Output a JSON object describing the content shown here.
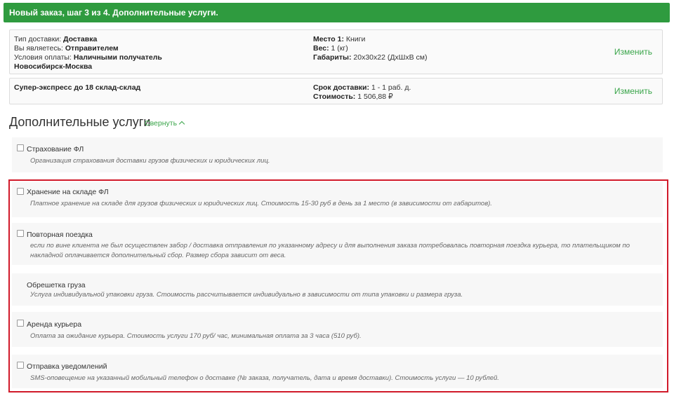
{
  "header": {
    "title": "Новый заказ, шаг 3 из 4. Дополнительные услуги."
  },
  "summary": {
    "delivery_type_label": "Тип доставки:",
    "delivery_type_value": "Доставка",
    "role_label": "Вы являетесь:",
    "role_value": "Отправителем",
    "payment_label": "Условия оплаты:",
    "payment_value": "Наличными получатель",
    "route": "Новосибирск-Москва",
    "place_label": "Место 1:",
    "place_value": "Книги",
    "weight_label": "Вес:",
    "weight_value": "1 (кг)",
    "dims_label": "Габариты:",
    "dims_value": "20x30x22 (ДхШхВ см)",
    "change_label": "Изменить"
  },
  "tariff": {
    "name": "Супер-экспресс до 18 склад-склад",
    "term_label": "Срок доставки:",
    "term_value": "1 - 1 раб. д.",
    "cost_label": "Стоимость:",
    "cost_value": "1 506,88 ₽",
    "change_label": "Изменить"
  },
  "section": {
    "title": "Дополнительные услуги",
    "collapse_label": "Свернуть"
  },
  "services": [
    {
      "title": "Страхование ФЛ",
      "checkbox": true,
      "desc": "Организация страхования доставки грузов физических и юридических лиц."
    },
    {
      "title": "Хранение на складе ФЛ",
      "checkbox": true,
      "desc": "Платное хранение на складе для грузов физических и юридических лиц. Стоимость 15-30 руб в день за 1 место (в зависимости от габаритов)."
    },
    {
      "title": "Повторная поездка",
      "checkbox": true,
      "desc": "если по вине клиента не был осуществлен забор / доставка отправления по указанному адресу и для выполнения заказа потребовалась повторная поездка курьера, то плательщиком по накладной оплачивается дополнительный сбор. Размер сбора зависит от веса."
    },
    {
      "title": "Обрешетка груза",
      "checkbox": false,
      "desc": "Услуга индивидуальной упаковки груза. Стоимость рассчитывается индивидуально в зависимости от типа упаковки и размера груза."
    },
    {
      "title": "Аренда курьера",
      "checkbox": true,
      "desc": "Оплата за ожидание курьера. Стоимость услуги 170 руб/ час, минимальная оплата за 3 часа (510 руб)."
    },
    {
      "title": "Отправка уведомлений",
      "checkbox": true,
      "desc": "SMS-оповещение на указанный мобильный телефон о доставке (№ заказа, получатель, дата и время доставки). Стоимость услуги — 10 рублей."
    }
  ],
  "highlight_color": "#d11a2a",
  "accent_color": "#2f9b3f"
}
